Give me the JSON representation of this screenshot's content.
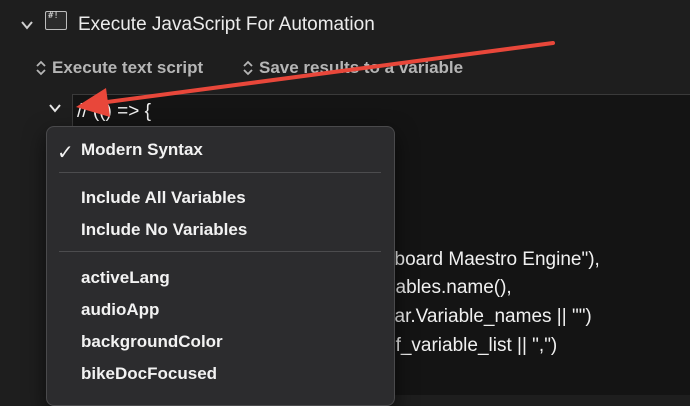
{
  "header": {
    "title": "Execute JavaScript For Automation",
    "icon_glyph": "#!"
  },
  "options": {
    "mode_label": "Execute text script",
    "results_label": "Save results to a variable"
  },
  "editor": {
    "lines": [
      "// (() => {",
      "yboard Maestro Engine\"),",
      "riables.name(),",
      "var.Variable_names || \"\")",
      "of_variable_list || \",\")"
    ]
  },
  "menu": {
    "modern_syntax": "Modern Syntax",
    "check_glyph": "✓",
    "include_all": "Include All Variables",
    "include_none": "Include No Variables",
    "variables": [
      "activeLang",
      "audioApp",
      "backgroundColor",
      "bikeDocFocused"
    ]
  },
  "colors": {
    "arrow": "#e8473a",
    "background": "#1e1e1e",
    "menu_bg": "#2c2c2e"
  }
}
